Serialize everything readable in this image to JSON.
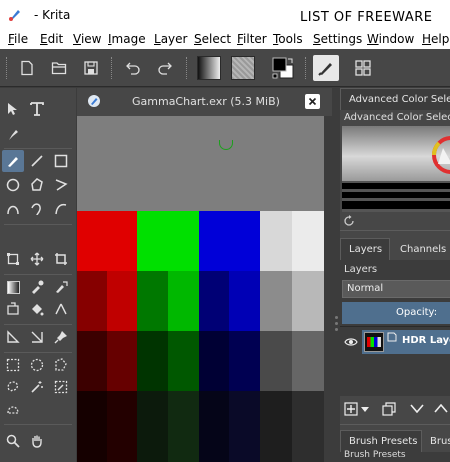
{
  "window": {
    "title": "- Krita",
    "banner": "LIST OF FREEWARE"
  },
  "menu": [
    "File",
    "Edit",
    "View",
    "Image",
    "Layer",
    "Select",
    "Filter",
    "Tools",
    "Settings",
    "Window",
    "Help"
  ],
  "toolbar": {
    "icons": [
      "new-document-icon",
      "open-document-icon",
      "save-icon",
      "undo-icon",
      "redo-icon",
      "gradient-icon",
      "pattern-icon",
      "color-swatch-icon",
      "brush-preset-icon",
      "wrap-mode-icon"
    ]
  },
  "document": {
    "name": "GammaChart.exr",
    "size": "5.3 MiB",
    "title": "GammaChart.exr (5.3 MiB)"
  },
  "colors": {
    "red": "#e00000",
    "green": "#00e000",
    "blue": "#0000d8",
    "white": "#e8e8e8",
    "ui_dark": "#474747",
    "ui_bg": "#3c3c3c",
    "accent": "#5a7796"
  },
  "dockers": {
    "advanced_color": {
      "tab": "Advanced Color Sele...",
      "title": "Advanced Color Selector"
    },
    "layers_tabs": [
      {
        "label": "Layers",
        "active": true
      },
      {
        "label": "Channels",
        "active": false
      }
    ],
    "layers": {
      "section_label": "Layers",
      "blend_mode": "Normal",
      "opacity_label": "Opacity:",
      "layer_name": "HDR Layer"
    },
    "brush_tabs": [
      {
        "label": "Brush Presets",
        "active": true
      },
      {
        "label": "Brus",
        "active": false
      }
    ],
    "brush_presets_label": "Brush Presets"
  }
}
